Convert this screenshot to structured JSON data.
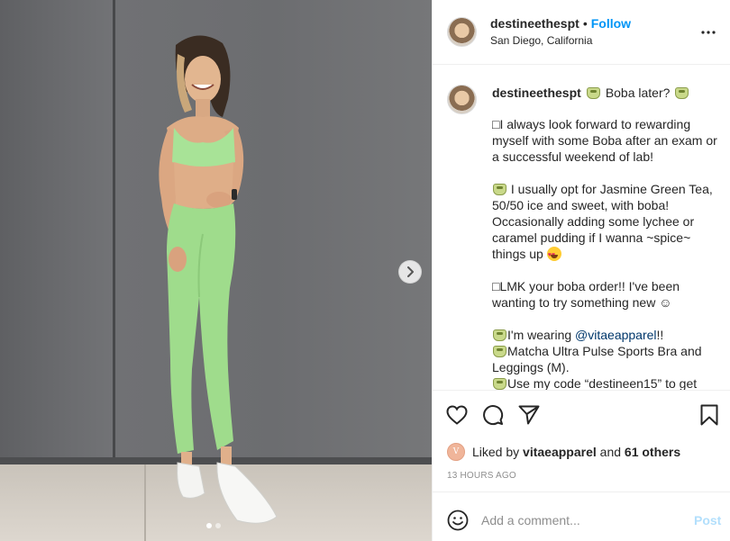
{
  "photo": {
    "carousel_total": 2,
    "carousel_active": 1
  },
  "header": {
    "username": "destineethespt",
    "separator": "•",
    "follow_label": "Follow",
    "location": "San Diego, California"
  },
  "caption": {
    "username": "destineethespt",
    "title": "Boba later?",
    "para1": "□I always look forward to rewarding myself with some Boba after an exam or a successful weekend of lab!",
    "para2": "I usually opt for Jasmine Green Tea, 50/50 ice and sweet, with boba! Occasionally adding some lychee or caramel pudding if I wanna ~spice~ things up",
    "para3": "□LMK your boba order!! I've been wanting to try something new ☺",
    "line4a_prefix": "I'm wearing ",
    "line4a_mention": "@vitaeapparel",
    "line4a_suffix": "!!",
    "line4b": "Matcha Ultra Pulse Sports Bra and Leggings (M).",
    "line4c": "Use my code “destineen15” to get"
  },
  "actions": {
    "liked_by_prefix": "Liked by",
    "liked_by_user": "vitaeapparel",
    "liked_by_and": "and",
    "liked_by_others": "61 others",
    "mini_avatar_letter": "V",
    "timestamp": "13 HOURS AGO"
  },
  "comment": {
    "placeholder": "Add a comment...",
    "post_label": "Post"
  },
  "colors": {
    "accent": "#0095f6",
    "post_disabled": "#b2dffc",
    "outfit": "#9fdc8c"
  }
}
